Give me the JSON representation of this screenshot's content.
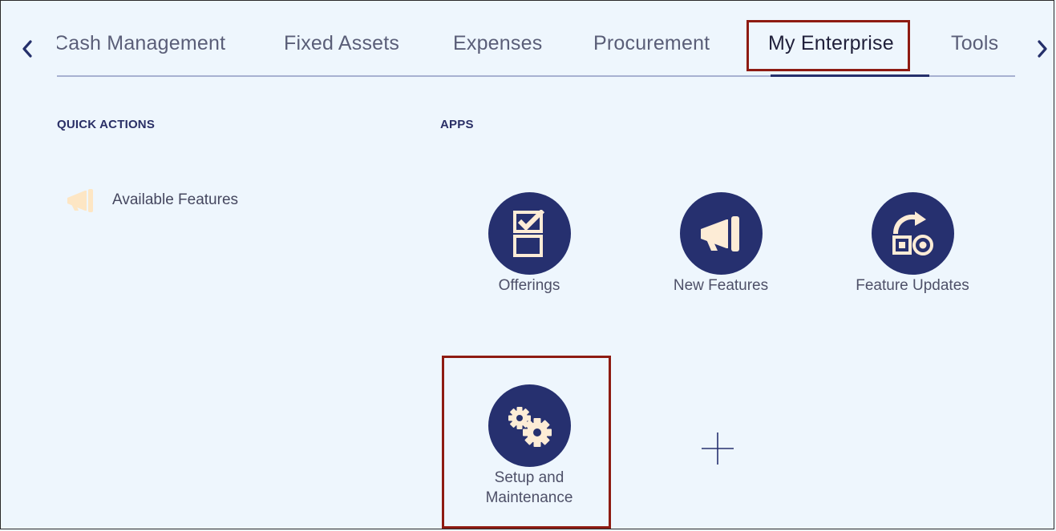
{
  "tabs": [
    {
      "label": "Cash Management"
    },
    {
      "label": "Fixed Assets"
    },
    {
      "label": "Expenses"
    },
    {
      "label": "Procurement"
    },
    {
      "label": "My Enterprise",
      "active": true
    },
    {
      "label": "Tools"
    }
  ],
  "quick_actions": {
    "title": "QUICK ACTIONS",
    "items": [
      {
        "label": "Available Features",
        "icon": "megaphone-icon"
      }
    ]
  },
  "apps": {
    "title": "APPS",
    "items": [
      {
        "label": "Offerings",
        "icon": "checklist-icon"
      },
      {
        "label": "New Features",
        "icon": "megaphone-icon"
      },
      {
        "label": "Feature Updates",
        "icon": "feature-updates-icon"
      },
      {
        "label": "Setup and Maintenance",
        "label_line1": "Setup and",
        "label_line2": "Maintenance",
        "icon": "gears-icon"
      }
    ],
    "add_icon": "plus-icon"
  },
  "colors": {
    "background": "#eef6fd",
    "app_circle": "#26306f",
    "icon_fill": "#fdecd6",
    "highlight": "#8e1b12"
  }
}
